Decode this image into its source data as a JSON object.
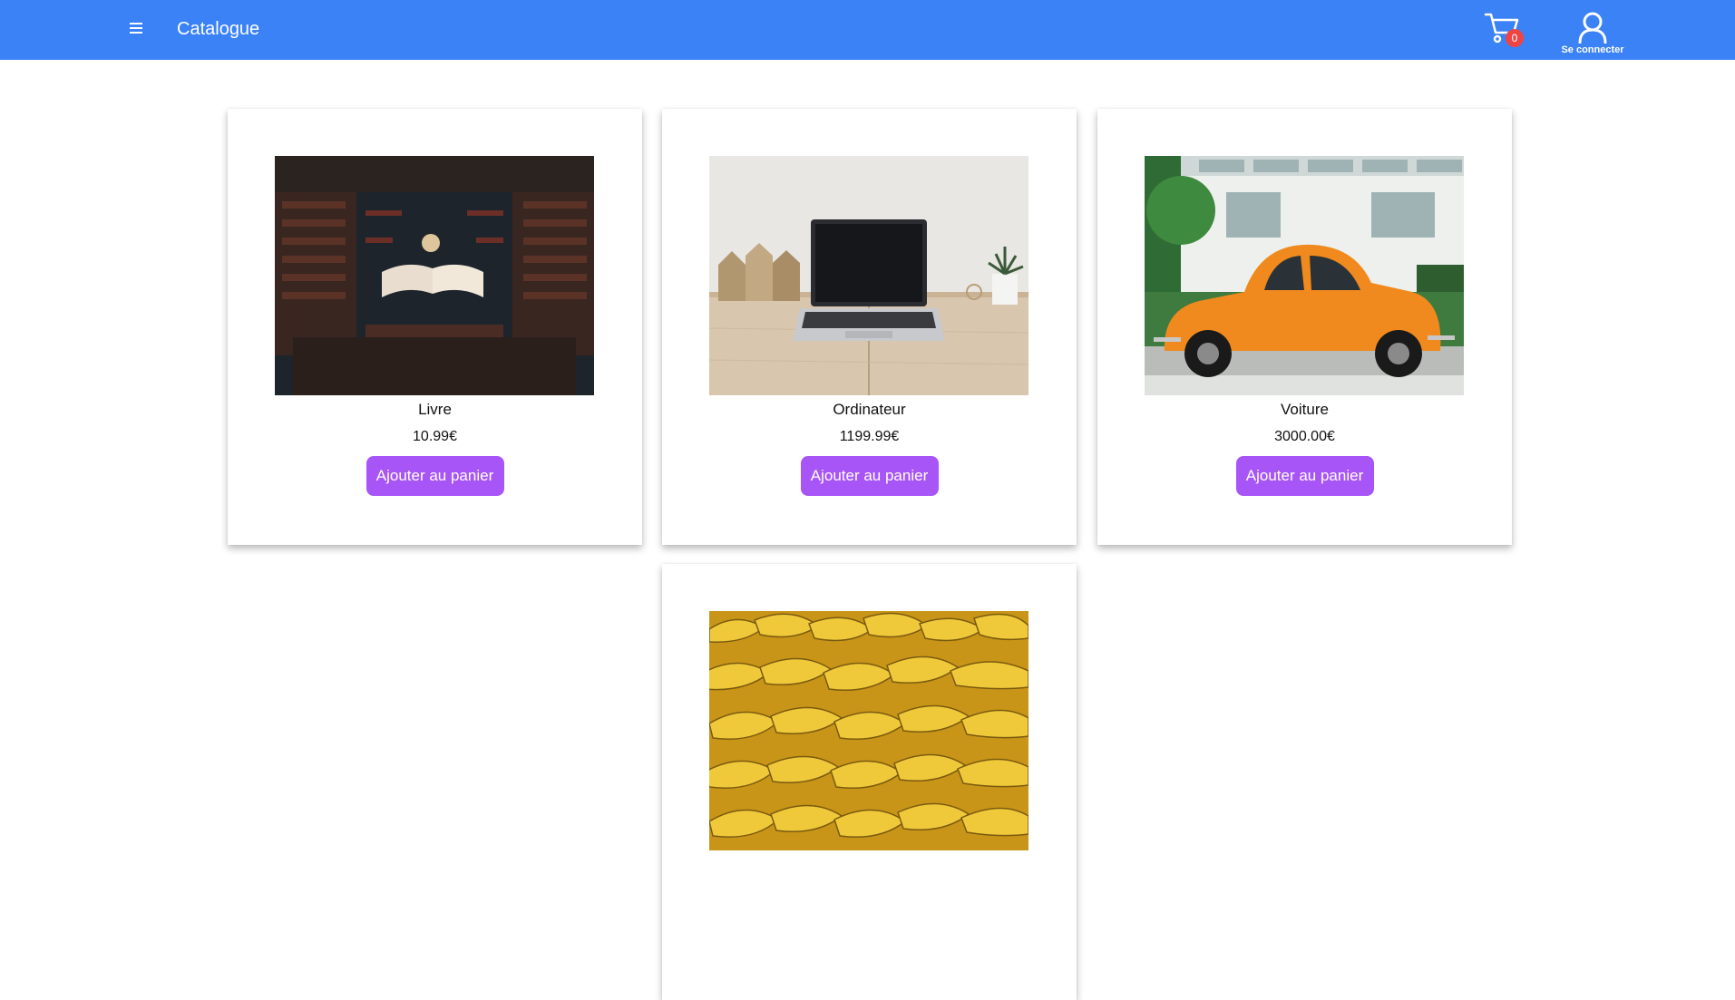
{
  "header": {
    "title": "Catalogue",
    "menu_icon": "hamburger-menu-icon",
    "cart_icon": "shopping-cart-icon",
    "cart_count": "0",
    "login_icon": "user-icon",
    "login_label": "Se connecter",
    "bar_color": "#3b82f6",
    "badge_color": "#ef4444"
  },
  "products": [
    {
      "name": "Livre",
      "price": "10.99€",
      "button_label": "Ajouter au panier",
      "image": "open book in a library"
    },
    {
      "name": "Ordinateur",
      "price": "1199.99€",
      "button_label": "Ajouter au panier",
      "image": "laptop on a wooden desk"
    },
    {
      "name": "Voiture",
      "price": "3000.00€",
      "button_label": "Ajouter au panier",
      "image": "orange vintage car"
    },
    {
      "name": "",
      "price": "",
      "button_label": "",
      "image": "pile of bananas"
    }
  ],
  "button_color": "#a855f7"
}
